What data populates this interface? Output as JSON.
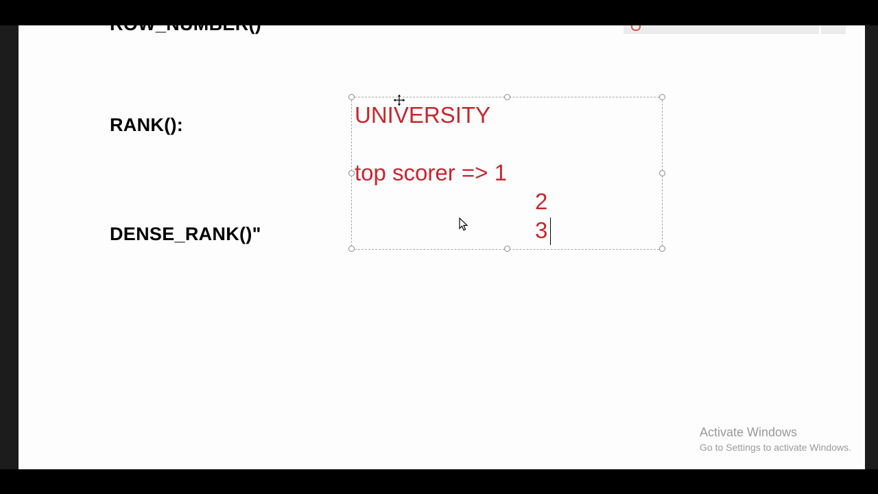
{
  "slide": {
    "row_number_heading": "ROW_NUMBER()",
    "rank_heading": "RANK():",
    "dense_rank_heading": "DENSE_RANK()\""
  },
  "textbox": {
    "line1": "UNIVERSITY",
    "line2": "top scorer => 1",
    "line3": "2",
    "line4": "3",
    "text_color": "#c8262e"
  },
  "icons": {
    "move": "move-cursor-icon",
    "pointer": "mouse-pointer-icon",
    "ribbon": "ribbon-app-icon"
  },
  "watermark": {
    "title": "Activate Windows",
    "subtitle": "Go to Settings to activate Windows."
  }
}
